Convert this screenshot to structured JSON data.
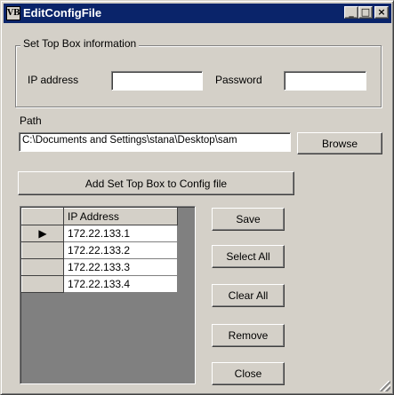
{
  "window": {
    "title": "EditConfigFile",
    "icon_text": "VB"
  },
  "controls": {
    "minimize": "_",
    "maximize": "□",
    "close": "×"
  },
  "stb_group": {
    "title": "Set Top Box information",
    "ip_label": "IP address",
    "ip_value": "",
    "password_label": "Password",
    "password_value": ""
  },
  "path": {
    "label": "Path",
    "value": "C:\\Documents and Settings\\stana\\Desktop\\sam",
    "browse_label": "Browse"
  },
  "add_button_label": "Add Set Top Box to Config file",
  "grid": {
    "column_header": "IP Address",
    "current_row_marker": "▶",
    "rows": [
      "172.22.133.1",
      "172.22.133.2",
      "172.22.133.3",
      "172.22.133.4"
    ]
  },
  "buttons": {
    "save": "Save",
    "select_all": "Select All",
    "clear_all": "Clear All",
    "remove": "Remove",
    "close": "Close"
  }
}
